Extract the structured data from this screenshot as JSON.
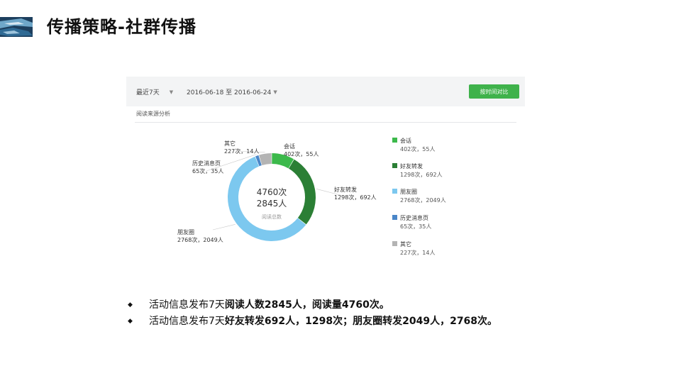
{
  "slide": {
    "title": "传播策略-社群传播"
  },
  "panel": {
    "range_label": "最近7天",
    "date_range": "2016-06-18 至 2016-06-24",
    "compare_button": "按时间对比",
    "section_title": "阅读来源分析"
  },
  "chart_data": {
    "type": "pie",
    "donut": true,
    "center": {
      "primary": "4760次",
      "secondary": "2845人",
      "caption": "阅读总数"
    },
    "slices": [
      {
        "name": "会话",
        "reads": 402,
        "people": 55,
        "label": "402次，55人",
        "legend_value": "402次，55人",
        "color": "#3cb94b"
      },
      {
        "name": "好友转发",
        "reads": 1298,
        "people": 692,
        "label": "1298次，692人",
        "legend_value": "1298次，692人",
        "color": "#2b7f35"
      },
      {
        "name": "朋友圈",
        "reads": 2768,
        "people": 2049,
        "label": "2768次，2049人",
        "legend_value": "2768次，2049人",
        "color": "#7cc8ef"
      },
      {
        "name": "历史消息页",
        "reads": 65,
        "people": 35,
        "label": "65次，35人",
        "legend_value": "65次，35人",
        "color": "#4a86c8"
      },
      {
        "name": "其它",
        "reads": 227,
        "people": 14,
        "label": "227次，14人",
        "legend_value": "227次，14人",
        "color": "#b4b4b4"
      }
    ],
    "legend_position": "right"
  },
  "bullets": [
    {
      "marker": "◆",
      "prefix": "活动信息发布7天",
      "bold": "阅读人数2845人，阅读量4760次。"
    },
    {
      "marker": "◆",
      "prefix": "活动信息发布7天",
      "bold": "好友转发692人，1298次；朋友圈转发2049人，2768次。"
    }
  ]
}
